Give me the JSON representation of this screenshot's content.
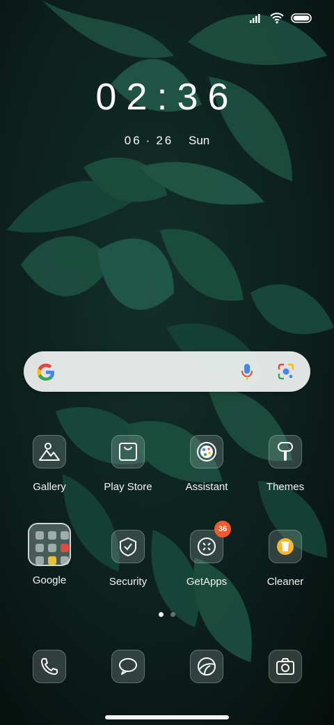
{
  "status": {
    "signal_icon": "signal-bars-icon",
    "wifi_icon": "wifi-icon",
    "battery_icon": "battery-icon"
  },
  "lockscreen": {
    "time": "02:36",
    "date_month": "06",
    "date_day": "26",
    "date_weekday": "Sun"
  },
  "search": {
    "logo_icon": "google-g-icon",
    "voice_icon": "microphone-icon",
    "lens_icon": "google-lens-icon"
  },
  "apps": [
    {
      "label": "Gallery",
      "icon": "gallery-icon"
    },
    {
      "label": "Play Store",
      "icon": "play-store-icon"
    },
    {
      "label": "Assistant",
      "icon": "assistant-icon"
    },
    {
      "label": "Themes",
      "icon": "themes-icon"
    },
    {
      "label": "Google",
      "icon": "folder-icon"
    },
    {
      "label": "Security",
      "icon": "security-icon"
    },
    {
      "label": "GetApps",
      "icon": "getapps-icon",
      "badge": "36"
    },
    {
      "label": "Cleaner",
      "icon": "cleaner-icon"
    }
  ],
  "dock": [
    {
      "icon": "phone-icon"
    },
    {
      "icon": "messages-icon"
    },
    {
      "icon": "browser-icon"
    },
    {
      "icon": "camera-icon"
    }
  ],
  "colors": {
    "badge": "#f25a2a",
    "leaf": "#1f5c4a",
    "background": "#0f1f1c"
  }
}
